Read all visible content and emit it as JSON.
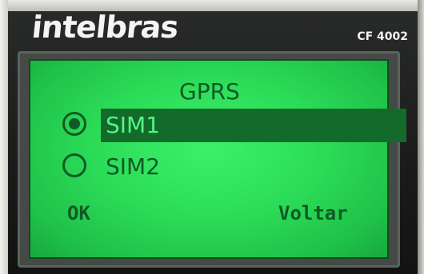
{
  "device": {
    "brand": "intelbras",
    "model": "CF 4002"
  },
  "screen": {
    "title": "GPRS",
    "options": [
      {
        "label": "SIM1",
        "selected": true
      },
      {
        "label": "SIM2",
        "selected": false
      }
    ],
    "softkeys": {
      "left": "OK",
      "right": "Voltar"
    }
  },
  "colors": {
    "lcd_background": "#2cdc58",
    "lcd_text": "#0f5a26",
    "selection_highlight": "#126b2b"
  }
}
